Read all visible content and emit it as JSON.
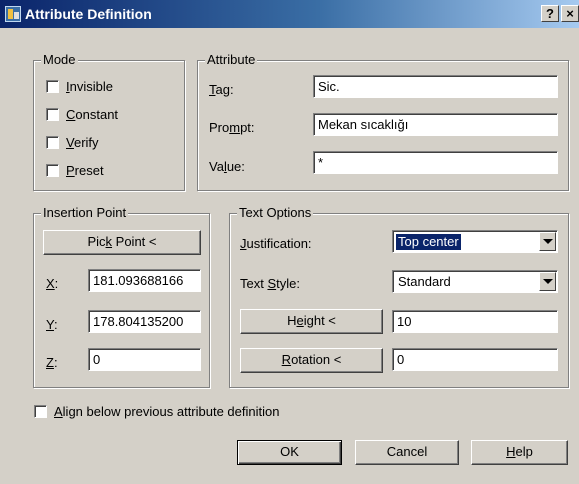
{
  "window": {
    "title": "Attribute Definition",
    "help_glyph": "?",
    "close_glyph": "×"
  },
  "mode": {
    "legend": "Mode",
    "options": [
      {
        "pre": "",
        "key": "I",
        "post": "nvisible",
        "checked": false
      },
      {
        "pre": "",
        "key": "C",
        "post": "onstant",
        "checked": false
      },
      {
        "pre": "",
        "key": "V",
        "post": "erify",
        "checked": false
      },
      {
        "pre": "",
        "key": "P",
        "post": "reset",
        "checked": false
      }
    ]
  },
  "attribute": {
    "legend": "Attribute",
    "tag": {
      "pre": "",
      "key": "T",
      "post": "ag:",
      "value": "Sic."
    },
    "prompt": {
      "pre": "Pro",
      "key": "m",
      "post": "pt:",
      "value": "Mekan sıcaklığı"
    },
    "value": {
      "pre": "Va",
      "key": "l",
      "post": "ue:",
      "value": "*"
    }
  },
  "insertion": {
    "legend": "Insertion Point",
    "pick": {
      "pre": "Pic",
      "key": "k",
      "post": " Point <"
    },
    "x": {
      "key": "X",
      "post": ":",
      "value": "181.093688166"
    },
    "y": {
      "key": "Y",
      "post": ":",
      "value": "178.804135200"
    },
    "z": {
      "key": "Z",
      "post": ":",
      "value": "0"
    }
  },
  "text_options": {
    "legend": "Text Options",
    "justification": {
      "pre": "",
      "key": "J",
      "post": "ustification:",
      "value": "Top center"
    },
    "text_style": {
      "pre": "Text ",
      "key": "S",
      "post": "tyle:",
      "value": "Standard"
    },
    "height": {
      "pre": "H",
      "key": "e",
      "post": "ight <",
      "value": "10"
    },
    "rotation": {
      "pre": "",
      "key": "R",
      "post": "otation <",
      "value": "0"
    }
  },
  "align": {
    "pre": "",
    "key": "A",
    "post": "lign below previous attribute definition",
    "checked": false
  },
  "buttons": {
    "ok": "OK",
    "cancel": "Cancel",
    "help": {
      "pre": "",
      "key": "H",
      "post": "elp"
    }
  }
}
